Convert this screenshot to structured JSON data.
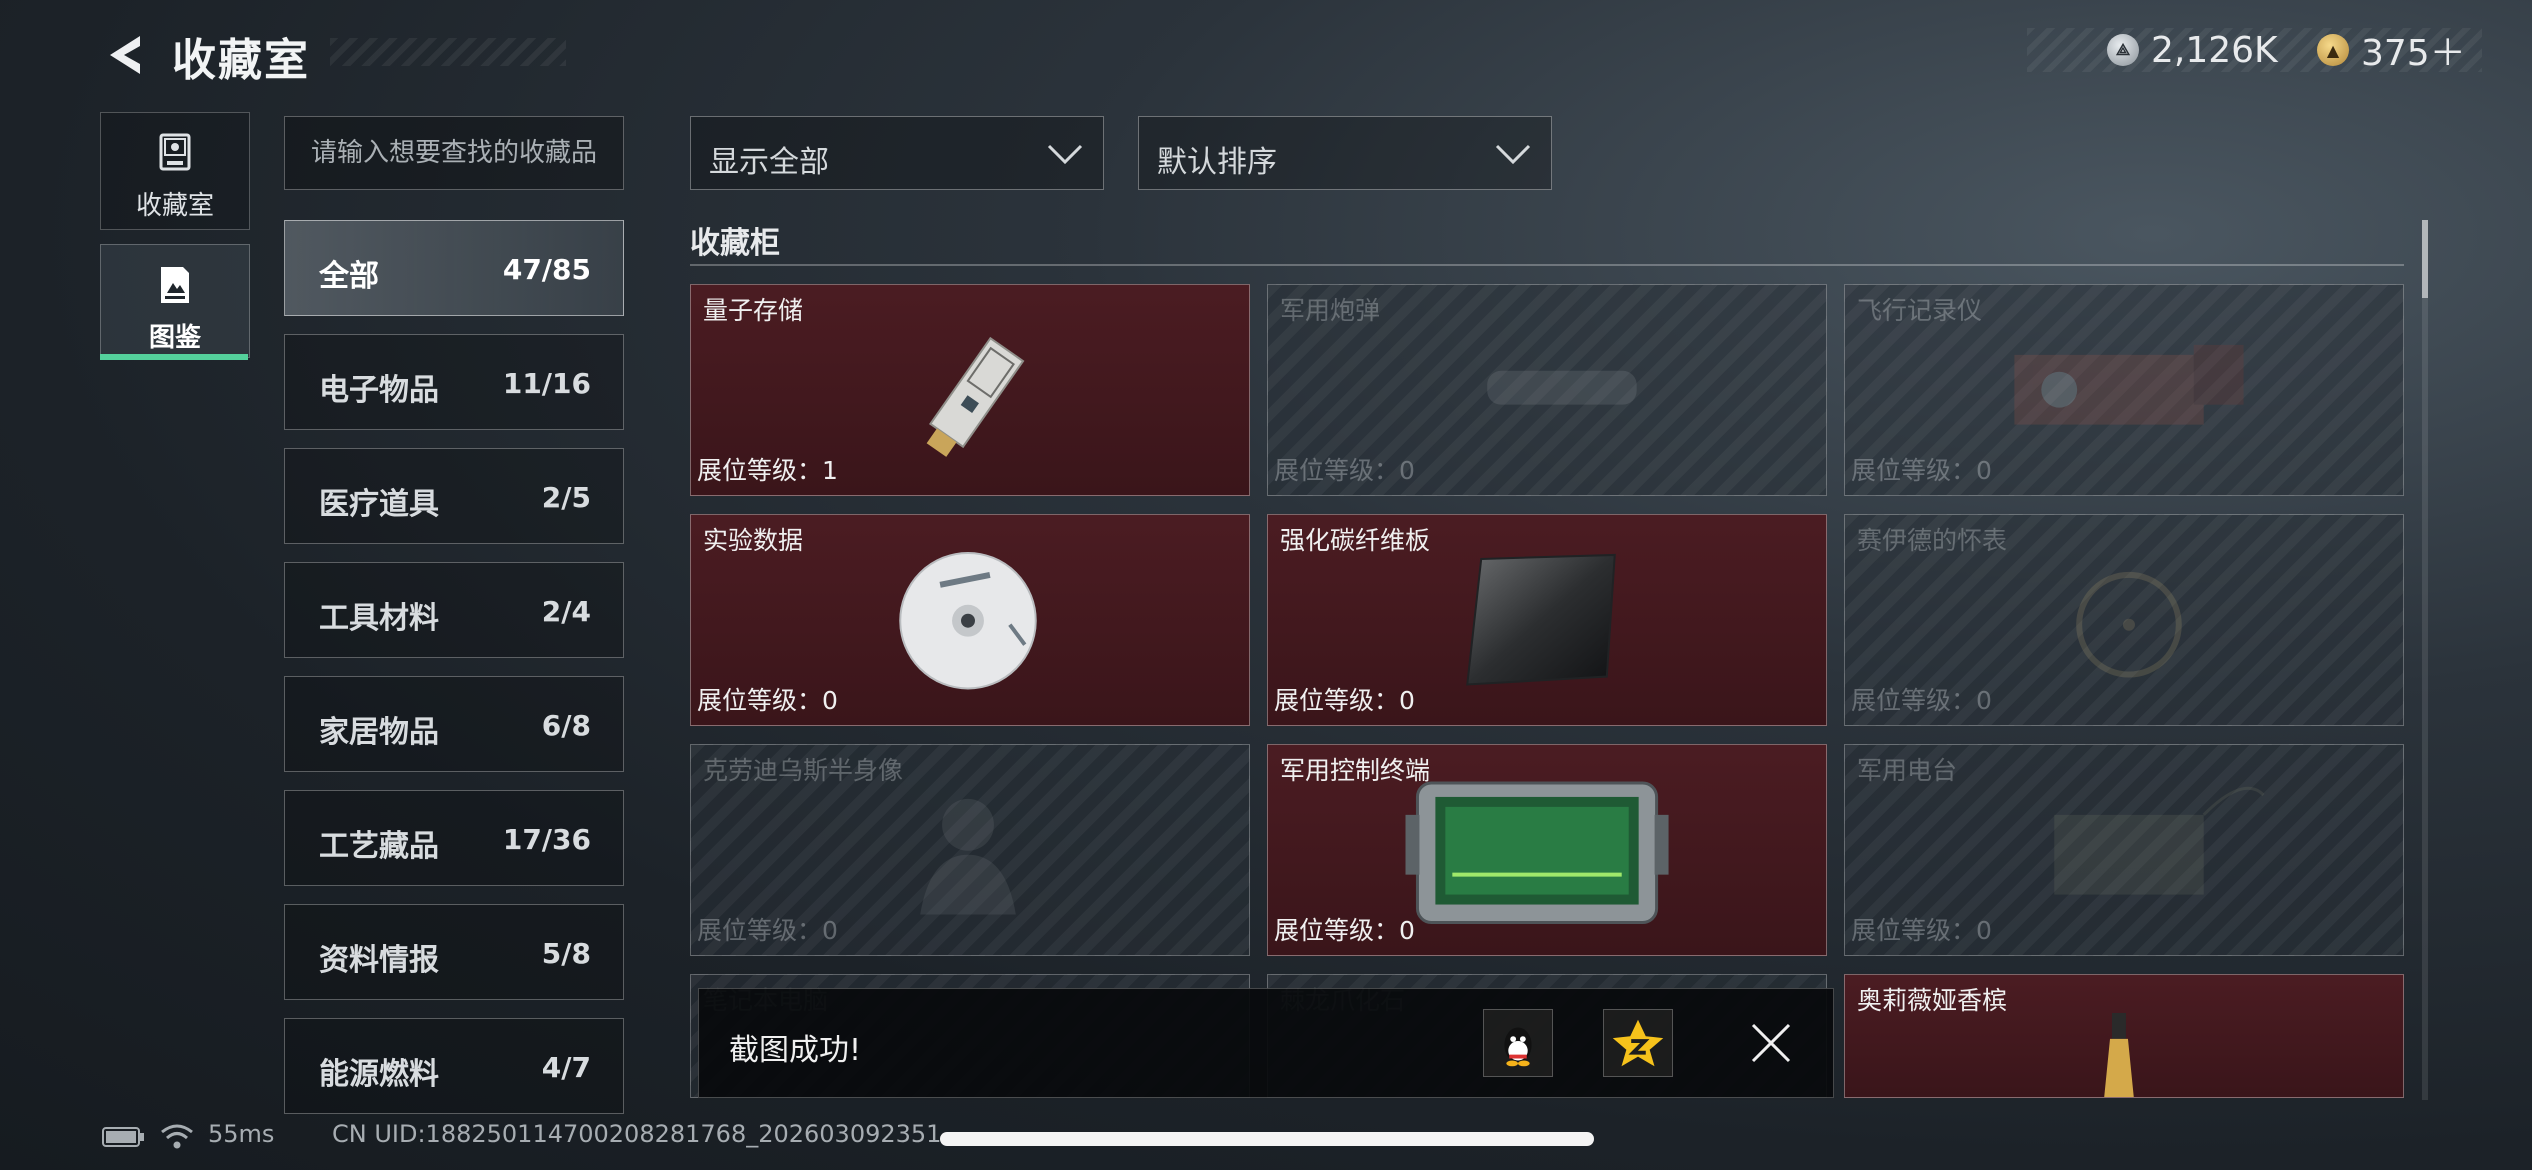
{
  "header": {
    "title": "收藏室",
    "currency": [
      {
        "icon": "silver-coin-icon",
        "value": "2,126K"
      },
      {
        "icon": "gold-coin-icon",
        "value": "375＋"
      }
    ]
  },
  "left_nav": {
    "items": [
      {
        "label": "收藏室",
        "icon": "collection-room-icon",
        "selected": false
      },
      {
        "label": "图鉴",
        "icon": "catalog-icon",
        "selected": true
      }
    ],
    "accent_color": "#54d19c"
  },
  "search": {
    "placeholder": "请输入想要查找的收藏品"
  },
  "categories": [
    {
      "name": "全部",
      "count": "47/85",
      "active": true
    },
    {
      "name": "电子物品",
      "count": "11/16"
    },
    {
      "name": "医疗道具",
      "count": "2/5"
    },
    {
      "name": "工具材料",
      "count": "2/4"
    },
    {
      "name": "家居物品",
      "count": "6/8"
    },
    {
      "name": "工艺藏品",
      "count": "17/36"
    },
    {
      "name": "资料情报",
      "count": "5/8"
    },
    {
      "name": "能源燃料",
      "count": "4/7"
    }
  ],
  "filters": {
    "show": "显示全部",
    "sort": "默认排序"
  },
  "section": {
    "title": "收藏柜"
  },
  "items": [
    {
      "name": "量子存储",
      "level": "展位等级：1",
      "owned": true,
      "icon": "usb-drive-icon"
    },
    {
      "name": "军用炮弹",
      "level": "展位等级：0",
      "owned": false,
      "icon": "artillery-shell-icon"
    },
    {
      "name": "飞行记录仪",
      "level": "展位等级：0",
      "owned": false,
      "icon": "flight-recorder-icon"
    },
    {
      "name": "实验数据",
      "level": "展位等级：0",
      "owned": true,
      "icon": "disc-icon"
    },
    {
      "name": "强化碳纤维板",
      "level": "展位等级：0",
      "owned": true,
      "icon": "carbon-plate-icon"
    },
    {
      "name": "赛伊德的怀表",
      "level": "展位等级：0",
      "owned": false,
      "icon": "pocket-watch-icon"
    },
    {
      "name": "克劳迪乌斯半身像",
      "level": "展位等级：0",
      "owned": false,
      "icon": "bust-icon"
    },
    {
      "name": "军用控制终端",
      "level": "展位等级：0",
      "owned": true,
      "icon": "control-terminal-icon"
    },
    {
      "name": "军用电台",
      "level": "展位等级：0",
      "owned": false,
      "icon": "radio-icon"
    },
    {
      "name": "笔记本电脑",
      "level": "",
      "owned": false,
      "icon": "laptop-icon"
    },
    {
      "name": "棘龙爪化石",
      "level": "",
      "owned": true,
      "icon": "fossil-icon"
    },
    {
      "name": "奥莉薇娅香槟",
      "level": "",
      "owned": true,
      "icon": "champagne-icon"
    }
  ],
  "toast": {
    "text": "截图成功!",
    "share": [
      "qq-icon",
      "qzone-icon"
    ],
    "close": "close-icon"
  },
  "status_bar": {
    "ping": "55ms",
    "uid": "CN UID:1882501147002082817​68_202603092351"
  }
}
